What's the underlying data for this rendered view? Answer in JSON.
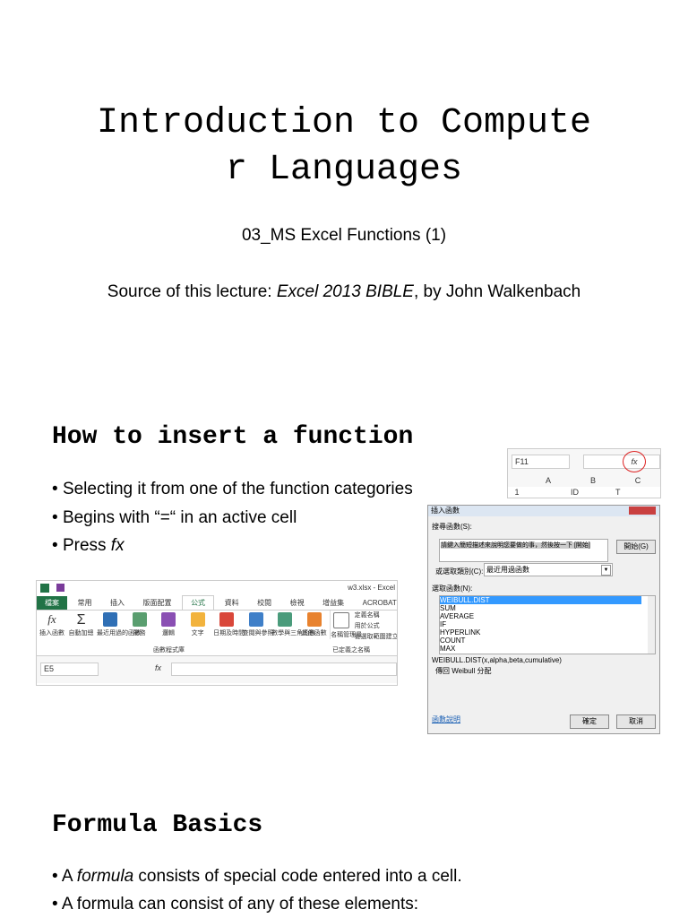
{
  "title_line1": "Introduction to Compute",
  "title_line2": "r Languages",
  "subtitle": "03_MS Excel Functions (1)",
  "source_prefix": "Source of this lecture: ",
  "source_book": "Excel 2013 BIBLE",
  "source_suffix": ", by John Walkenbach",
  "section1": {
    "heading": "How to insert a function",
    "bullets": [
      "Selecting it from one of the function categories",
      "Begins with “=“ in an active cell"
    ],
    "press_prefix": "Press ",
    "press_em": "fx"
  },
  "section2": {
    "heading": "Formula Basics",
    "b1_prefix": "A ",
    "b1_em": "formula",
    "b1_suffix": " consists of special code entered into a cell.",
    "b2": "A formula can consist of any of these elements:"
  },
  "formula_bar_small": {
    "name_box": "F11",
    "fx": "fx",
    "cols": [
      "A",
      "B",
      "C"
    ],
    "row": "1",
    "cells": [
      "",
      "ID",
      "T"
    ]
  },
  "ribbon": {
    "window_title": "w3.xlsx - Excel",
    "tabs": [
      "檔案",
      "常用",
      "插入",
      "版面配置",
      "公式",
      "資料",
      "校閱",
      "檢視",
      "增益集",
      "ACROBAT"
    ],
    "buttons": [
      "插入函數",
      "自動加總",
      "最近用過的函數",
      "財務",
      "邏輯",
      "文字",
      "日期及時間",
      "查閱與參照",
      "數學與三角函數",
      "其他函數"
    ],
    "names": [
      "名稱管理員",
      "定義名稱",
      "用於公式",
      "從選取範圍建立"
    ],
    "group1": "函數程式庫",
    "group2": "已定義之名稱",
    "name_box": "E5",
    "fx": "fx"
  },
  "dialog": {
    "title": "插入函數",
    "search_label": "搜尋函數(S):",
    "search_text": "請鍵入簡短描述來說明您要做的事，然後按一下 [開始]",
    "go": "開始(G)",
    "category_label": "或選取類別(C):",
    "category": "最近用過函數",
    "select_label": "選取函數(N):",
    "functions": [
      "WEIBULL.DIST",
      "SUM",
      "AVERAGE",
      "IF",
      "HYPERLINK",
      "COUNT",
      "MAX"
    ],
    "signature": "WEIBULL.DIST(x,alpha,beta,cumulative)",
    "description": "傳回 Weibull 分配",
    "help": "函數說明",
    "ok": "確定",
    "cancel": "取消"
  },
  "colors": {
    "accent_green": "#217346",
    "select_blue": "#3399ff",
    "circle_red": "#d22"
  }
}
